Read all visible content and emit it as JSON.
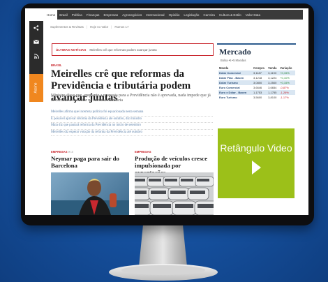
{
  "nav": {
    "items": [
      "Home",
      "Brasil",
      "Política",
      "Finanças",
      "Empresas",
      "Agronegócios",
      "Internacional",
      "Opinião",
      "Legislação",
      "Carreira",
      "Cultura & Estilo",
      "Valor Data"
    ],
    "active_index": 0
  },
  "subnav": {
    "items": [
      "Suplementos & Revistas",
      "Hoje no Valor",
      "Rumos 17"
    ]
  },
  "sidebar": {
    "orange_label": "Assine"
  },
  "ticker": {
    "label": "ÚLTIMAS NOTÍCIAS",
    "text": "Meirelles crê que reformas podem avançar juntas"
  },
  "main_story": {
    "kicker": "BRASIL",
    "headline": "Meirelles crê que reformas da Previdência e tributária podem avançar juntas",
    "lead": "Ministro disse que, enquanto a proposta para a Previdência não é aprovada, nada impede que já se comece a trabalhar na reforma tributária",
    "related": [
      "Meirelles afirma que incerteza política foi equacionada nesta semana",
      "É possível aprovar reforma da Previdência até outubro, diz ministro",
      "Maia diz que pautará reforma da Previdência no início de setembro",
      "Meirelles diz esperar votação da reforma da Previdência até outubro"
    ]
  },
  "card_left": {
    "kicker": "EMPRESAS",
    "count": "3",
    "title": "Neymar paga para sair do Barcelona"
  },
  "card_right": {
    "kicker": "EMPRESAS",
    "title": "Produção de veículos cresce impulsionada por exportações"
  },
  "market": {
    "title": "Mercado",
    "tabs": "Bolsa  •5  •5  Moedas",
    "headers": [
      "Moeda",
      "Compra",
      "Venda",
      "Variação"
    ],
    "rows": [
      {
        "name": "Dólar Comercial",
        "compra": "3,1187",
        "venda": "3,1193",
        "var": "+0,15%",
        "dir": "up"
      },
      {
        "name": "Dólar Ptax - Bacen",
        "compra": "3,1218",
        "venda": "3,1224",
        "var": "+0,10%",
        "dir": "up"
      },
      {
        "name": "Dólar Turismo",
        "compra": "3,0800",
        "venda": "3,2500",
        "var": "+0,15%",
        "dir": "up"
      },
      {
        "name": "Euro Comercial",
        "compra": "3,6646",
        "venda": "3,6654",
        "var": "-0,87%",
        "dir": "down"
      },
      {
        "name": "Euro x Dólar - Bacen",
        "compra": "1,1753",
        "venda": "1,1755",
        "var": "-1,26%",
        "dir": "down"
      },
      {
        "name": "Euro Turismo",
        "compra": "3,5600",
        "venda": "3,8100",
        "var": "-1,17%",
        "dir": "down"
      }
    ]
  },
  "video": {
    "text": "Retângulo Video"
  },
  "colors": {
    "accent_red": "#c9282f",
    "video_green": "#9cc019",
    "nav_dark": "#3a3a3a",
    "background_blue": "#1a5aaa"
  }
}
